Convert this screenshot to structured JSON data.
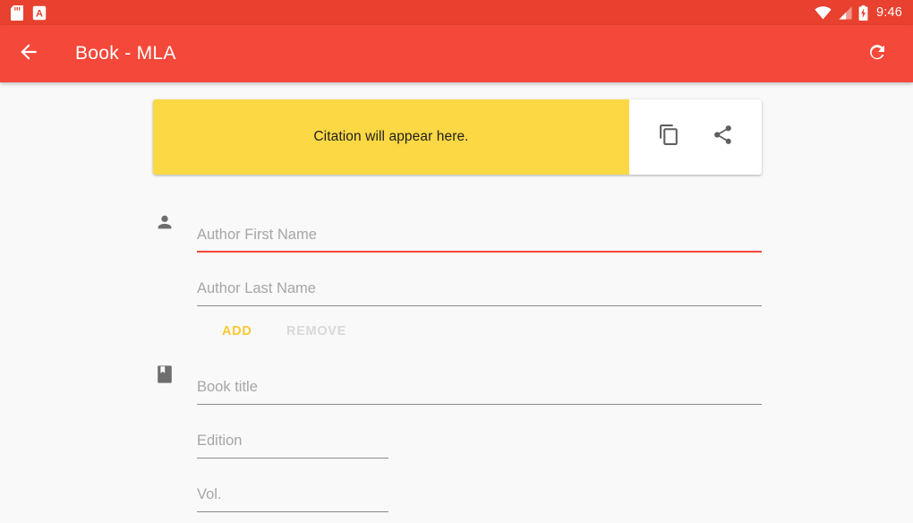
{
  "status_bar": {
    "icons": [
      "sd-card-icon",
      "letter-a-badge-icon"
    ],
    "right_icons": [
      "wifi-icon",
      "cell-signal-icon",
      "battery-charging-icon"
    ],
    "time": "9:46",
    "background_color": "#e8412f"
  },
  "app_bar": {
    "back_label": "back-arrow",
    "title": "Book - MLA",
    "refresh_label": "refresh",
    "background_color": "#f4483a",
    "text_color": "#ffffff"
  },
  "citation_card": {
    "text": "Citation will appear here.",
    "background_color": "#fbd844",
    "copy_label": "Copy",
    "share_label": "Share"
  },
  "form": {
    "fields": [
      {
        "name": "author-first-name",
        "placeholder": "Author First Name",
        "value": "",
        "icon": "person-icon",
        "focused": true,
        "width": "wide"
      },
      {
        "name": "author-last-name",
        "placeholder": "Author Last Name",
        "value": "",
        "icon": "",
        "focused": false,
        "width": "wide"
      },
      {
        "name": "book-title",
        "placeholder": "Book title",
        "value": "",
        "icon": "book-icon",
        "focused": false,
        "width": "wide"
      },
      {
        "name": "edition",
        "placeholder": "Edition",
        "value": "",
        "icon": "",
        "focused": false,
        "width": "half"
      },
      {
        "name": "volume",
        "placeholder": "Vol.",
        "value": "",
        "icon": "",
        "focused": false,
        "width": "half"
      }
    ],
    "add_label": "ADD",
    "remove_label": "REMOVE",
    "add_color": "#fcc834",
    "remove_color": "#d9d9d9"
  }
}
